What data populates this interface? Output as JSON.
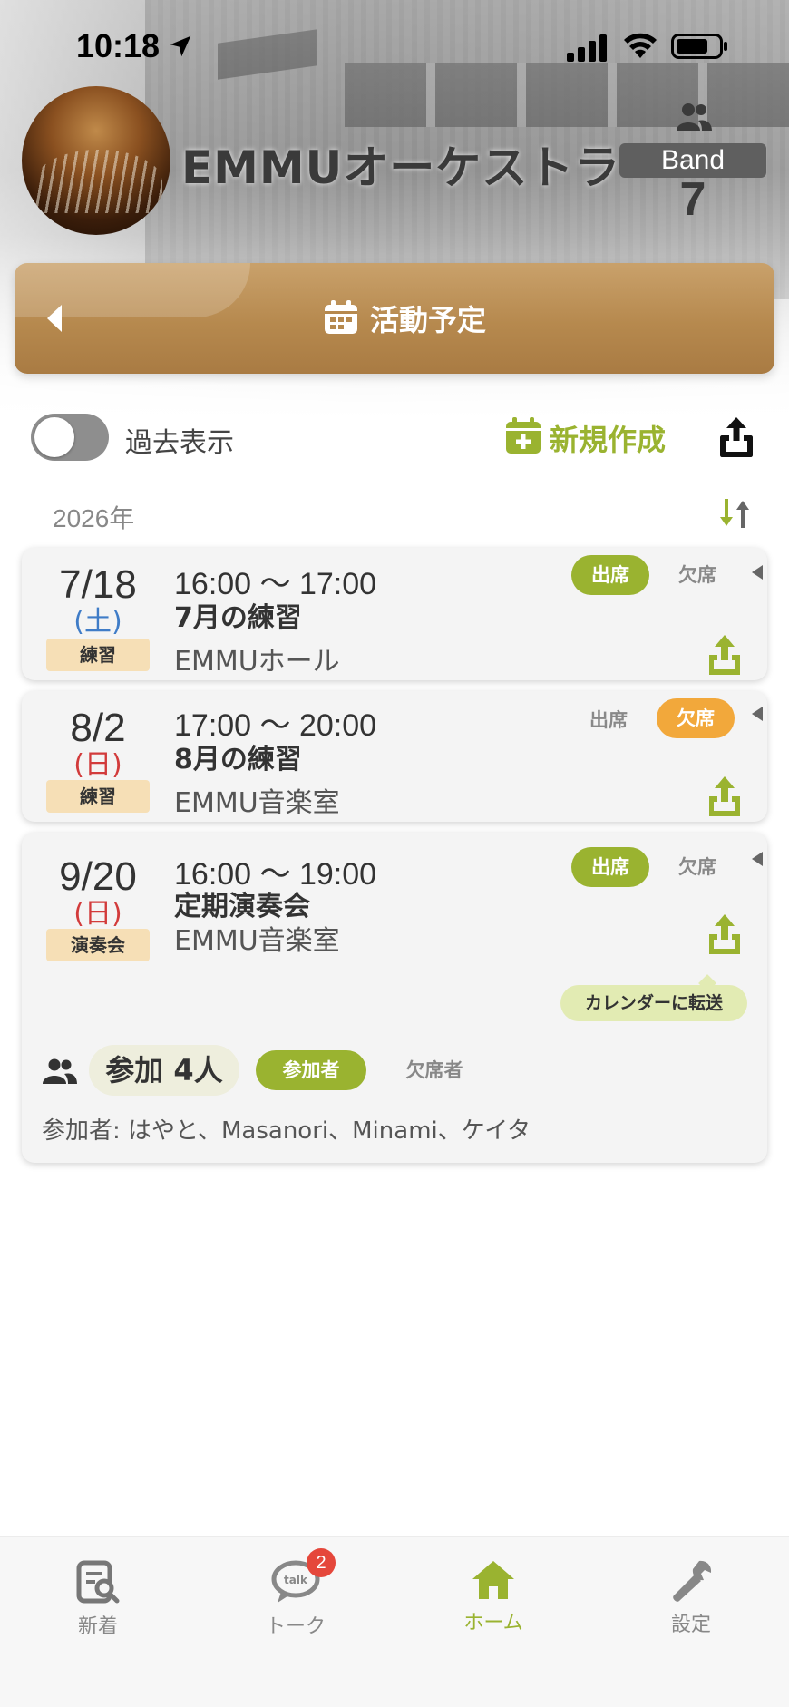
{
  "status_bar": {
    "time": "10:18"
  },
  "group": {
    "name": "EMMUオーケストラ",
    "badge": "Band",
    "member_count": "7"
  },
  "banner": {
    "title": "活動予定"
  },
  "controls": {
    "past_toggle_label": "過去表示",
    "past_toggle_on": false,
    "new_label": "新規作成"
  },
  "year": "2026年",
  "events": [
    {
      "date": "7/18",
      "dow": "(土)",
      "tag": "練習",
      "time": "16:00 〜 17:00",
      "title": "7月の練習",
      "place": "EMMUホール",
      "attend_label": "出席",
      "absent_label": "欠席",
      "selected": "attend"
    },
    {
      "date": "8/2",
      "dow": "(日)",
      "tag": "練習",
      "time": "17:00 〜 20:00",
      "title": "8月の練習",
      "place": "EMMU音楽室",
      "attend_label": "出席",
      "absent_label": "欠席",
      "selected": "absent"
    },
    {
      "date": "9/20",
      "dow": "(日)",
      "tag": "演奏会",
      "time": "16:00 〜 19:00",
      "title": "定期演奏会",
      "place": "EMMU音楽室",
      "attend_label": "出席",
      "absent_label": "欠席",
      "selected": "attend",
      "calendar_transfer": "カレンダーに転送",
      "attendance_count": "参加 4人",
      "participants_tab": "参加者",
      "absentees_tab": "欠席者",
      "participants_line": "参加者: はやと、Masanori、Minami、ケイタ"
    }
  ],
  "tabs": [
    {
      "label": "新着",
      "icon": "search-doc-icon"
    },
    {
      "label": "トーク",
      "icon": "talk-bubble-icon",
      "badge": "2"
    },
    {
      "label": "ホーム",
      "icon": "home-icon",
      "active": true
    },
    {
      "label": "設定",
      "icon": "wrench-icon"
    }
  ],
  "colors": {
    "accent_green": "#9ab330",
    "banner_gold": "#b6894e",
    "absent_orange": "#f2a83b",
    "tag_bg": "#f6dfb6",
    "badge_red": "#e5473b"
  }
}
